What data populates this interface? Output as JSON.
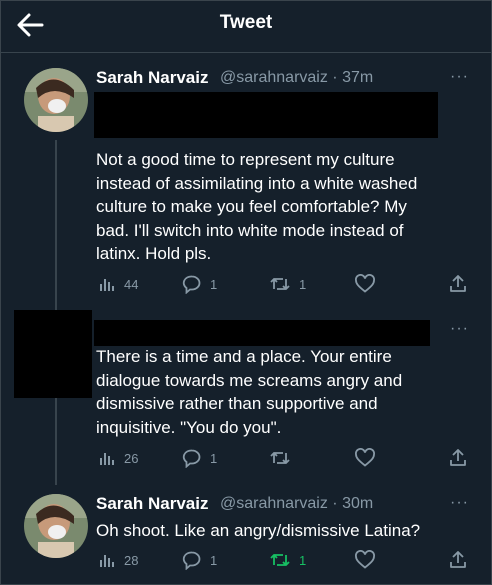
{
  "header": {
    "title": "Tweet"
  },
  "tweets": [
    {
      "name": "Sarah Narvaiz",
      "handle": "@sarahnarvaiz",
      "time": "· 37m",
      "text": "Not a good time to represent my culture\ninstead of assimilating into a white washed\nculture to make you feel comfortable? My\nbad. I'll switch into white mode instead of\nlatinx. Hold pls.",
      "views": "44",
      "replies": "1",
      "retweets": "1",
      "likes": ""
    },
    {
      "text": "There is a time and a place. Your entire\ndialogue towards me screams angry and\ndismissive rather than supportive and\ninquisitive. \"You do you\".",
      "views": "26",
      "replies": "1",
      "retweets": "",
      "likes": ""
    },
    {
      "name": "Sarah Narvaiz",
      "handle": "@sarahnarvaiz",
      "time": "· 30m",
      "text": "Oh shoot. Like an angry/dismissive Latina?",
      "views": "28",
      "replies": "1",
      "retweets": "1",
      "likes": ""
    }
  ],
  "more_label": "···",
  "colors": {
    "background": "#15202b",
    "muted": "#8899a6",
    "retweet_active": "#17bf63"
  },
  "icons": [
    "back-arrow-icon",
    "views-icon",
    "reply-icon",
    "retweet-icon",
    "like-icon",
    "share-icon",
    "more-icon"
  ]
}
